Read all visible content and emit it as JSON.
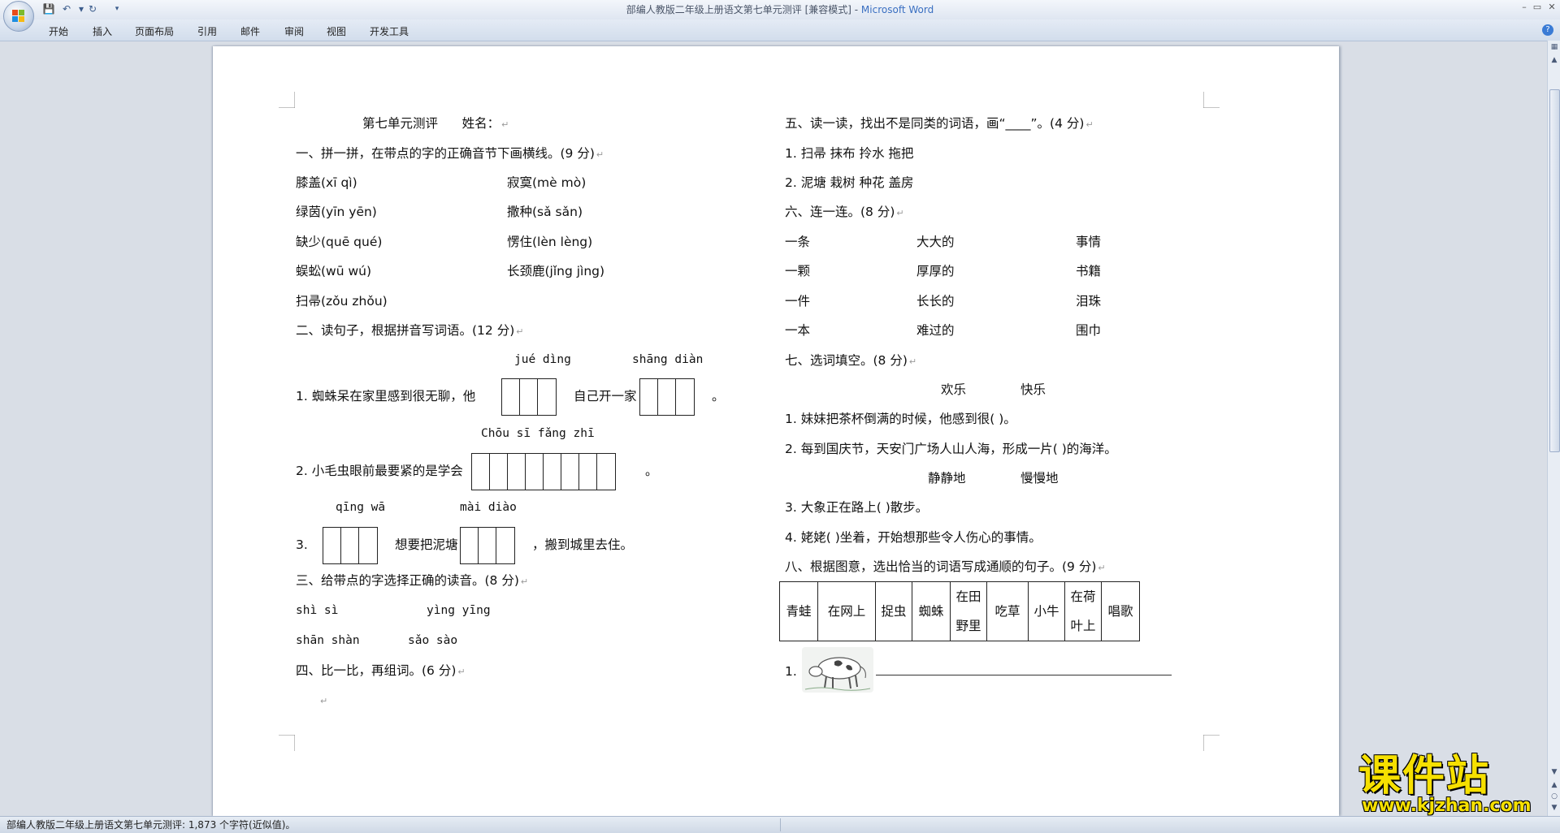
{
  "window": {
    "title_doc": "部编人教版二年级上册语文第七单元测评 [兼容模式] - ",
    "title_app": "Microsoft Word"
  },
  "ribbon_tabs": [
    "开始",
    "插入",
    "页面布局",
    "引用",
    "邮件",
    "审阅",
    "视图",
    "开发工具"
  ],
  "document": {
    "header_title": "第七单元测评",
    "header_name": "姓名：",
    "s1": {
      "heading": "一、拼一拼，在带点的字的正确音节下画横线。(9 分)",
      "items": [
        "膝盖(xī  qì)",
        "寂寞(mè  mò)",
        "绿茵(yīn  yēn)",
        "撒种(sǎ  sǎn)",
        "缺少(quē  qué)",
        "愣住(lèn  lèng)",
        "蜈蚣(wū  wú)",
        "长颈鹿(jǐng  jìng)",
        "扫帚(zǒu  zhǒu)"
      ]
    },
    "s2": {
      "heading": "二、读句子，根据拼音写词语。(12 分)",
      "py1a": "jué  dìng",
      "py1b": "shāng  diàn",
      "q1_pre": "1. 蜘蛛呆在家里感到很无聊，他",
      "q1_mid": "自己开一家",
      "q1_end": "。",
      "py2": "Chōu  sī   fǎng  zhī",
      "q2_pre": "2. 小毛虫眼前最要紧的是学会",
      "q2_end": "。",
      "py3a": "qīng  wā",
      "py3b": "mài  diào",
      "q3_num": "3.",
      "q3_mid": "想要把泥塘",
      "q3_end": "，搬到城里去住。"
    },
    "s3": {
      "heading": "三、给带点的字选择正确的读音。(8 分)",
      "r1a": "shì  sì",
      "r1b": "yìng  yīng",
      "r2a": "shān  shàn",
      "r2b": "sǎo  sào"
    },
    "s4": {
      "heading": "四、比一比，再组词。(6 分)"
    },
    "s5": {
      "heading": "五、读一读，找出不是同类的词语，画“____”。(4 分)",
      "l1": "1. 扫帚   抹布   拎水   拖把",
      "l2": "2. 泥塘   栽树   种花   盖房"
    },
    "s6": {
      "heading": "六、连一连。(8 分)",
      "col1": [
        "一条",
        "一颗",
        "一件",
        "一本"
      ],
      "col2": [
        "大大的",
        "厚厚的",
        "长长的",
        "难过的"
      ],
      "col3": [
        "事情",
        "书籍",
        "泪珠",
        "围巾"
      ]
    },
    "s7": {
      "heading": "七、选词填空。(8 分)",
      "w1": "欢乐",
      "w2": "快乐",
      "q1": "1. 妹妹把茶杯倒满的时候，他感到很(          )。",
      "q2": "2. 每到国庆节，天安门广场人山人海，形成一片(         )的海洋。",
      "w3": "静静地",
      "w4": "慢慢地",
      "q3": "3. 大象正在路上(            )散步。",
      "q4": "4. 姥姥(            )坐着，开始想那些令人伤心的事情。"
    },
    "s8": {
      "heading": "八、根据图意，选出恰当的词语写成通顺的句子。(9 分)",
      "cells": [
        "青蛙",
        "在网上",
        "捉虫",
        "蜘蛛",
        "在田\n野里",
        "吃草",
        "小牛",
        "在荷\n叶上",
        "唱歌"
      ],
      "q1_num": "1."
    }
  },
  "status_text": "部编人教版二年级上册语文第七单元测评: 1,873 个字符(近似值)。",
  "watermark": {
    "name": "课件站",
    "url": "www.kjzhan.com"
  }
}
